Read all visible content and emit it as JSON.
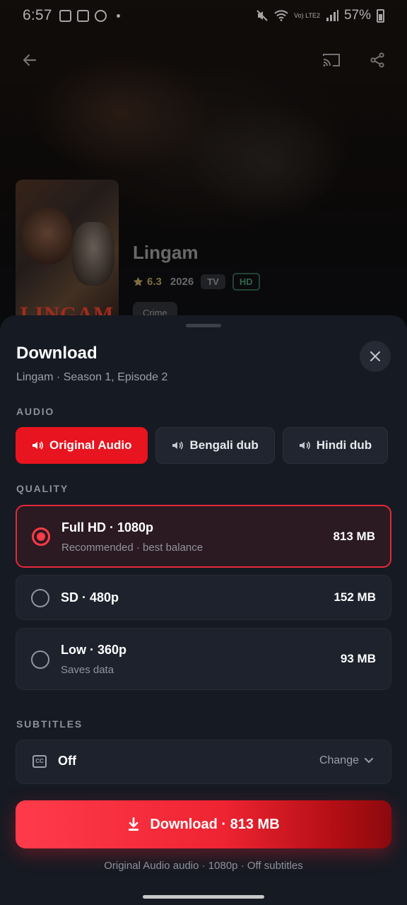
{
  "status_bar": {
    "time": "6:57",
    "network": "Vo) LTE2",
    "battery": "57%"
  },
  "show": {
    "poster_title": "LINGAM",
    "title": "Lingam",
    "rating": "6.3",
    "year": "2026",
    "type_badge": "TV",
    "quality_badge": "HD",
    "genre": "Crime"
  },
  "sheet": {
    "title": "Download",
    "subtitle": "Lingam · Season 1, Episode 2",
    "audio": {
      "label": "AUDIO",
      "options": [
        {
          "label": "Original Audio",
          "selected": true
        },
        {
          "label": "Bengali dub",
          "selected": false
        },
        {
          "label": "Hindi dub",
          "selected": false
        }
      ]
    },
    "quality": {
      "label": "QUALITY",
      "options": [
        {
          "title": "Full HD · 1080p",
          "desc": "Recommended · best balance",
          "size": "813 MB",
          "selected": true
        },
        {
          "title": "SD · 480p",
          "desc": "",
          "size": "152 MB",
          "selected": false
        },
        {
          "title": "Low · 360p",
          "desc": "Saves data",
          "size": "93 MB",
          "selected": false
        }
      ]
    },
    "subtitles": {
      "label": "SUBTITLES",
      "icon_text": "CC",
      "value": "Off",
      "change_label": "Change"
    },
    "download_button": "Download · 813 MB",
    "summary": "Original Audio audio · 1080p · Off subtitles"
  },
  "colors": {
    "accent": "#e8141f",
    "sheet_bg": "#161a23",
    "card_bg": "#1d222c",
    "selected_border": "#e5283a"
  }
}
